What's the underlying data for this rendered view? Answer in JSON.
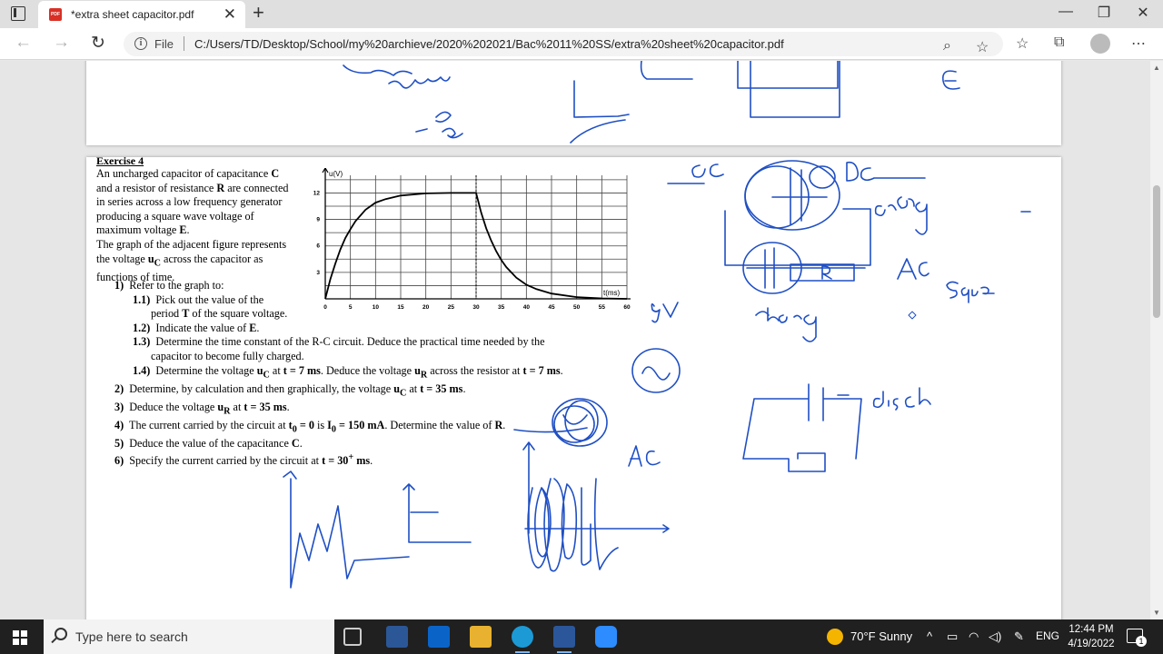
{
  "tab": {
    "title": "*extra sheet capacitor.pdf",
    "icon": "pdf-icon",
    "badge": "PDF"
  },
  "address": {
    "security_label": "File",
    "url": "C:/Users/TD/Desktop/School/my%20archieve/2020%202021/Bac%2011%20SS/extra%20sheet%20capacitor.pdf"
  },
  "document": {
    "exercise_title": "Exercise 4",
    "intro": [
      "An uncharged capacitor of capacitance <b>C</b>",
      "and a resistor of resistance <b>R</b> are connected",
      "in series across a low frequency generator",
      "producing a square wave voltage of",
      "maximum voltage <b>E</b>.",
      "The graph of the adjacent figure represents",
      "the voltage <b>u<sub>C</sub></b> across the capacitor as",
      "functions of time."
    ],
    "questions": [
      {
        "num": "1)",
        "text": "Refer to the graph to:",
        "indent": 0
      },
      {
        "num": "1.1)",
        "text": "Pick out the value of the",
        "indent": 1
      },
      {
        "num": "",
        "text": "period <b>T</b> of the square voltage.",
        "indent": 2
      },
      {
        "num": "1.2)",
        "text": "Indicate the value of <b>E</b>.",
        "indent": 1
      },
      {
        "num": "1.3)",
        "text": "Determine the time constant of the R-C circuit. Deduce the practical time needed by the",
        "indent": 1
      },
      {
        "num": "",
        "text": "capacitor to become fully charged.",
        "indent": 2
      },
      {
        "num": "1.4)",
        "text": "Determine the voltage <b>u<sub>C</sub></b> at <b>t = 7 ms</b>. Deduce the voltage <b>u<sub>R</sub></b> across the resistor at <b>t = 7 ms</b>.",
        "indent": 1
      },
      {
        "num": "2)",
        "text": "Determine, by calculation and then graphically, the voltage <b>u<sub>C</sub></b> at <b>t = 35 ms</b>.",
        "indent": 0
      },
      {
        "num": "3)",
        "text": "Deduce the voltage <b>u<sub>R</sub></b> at <b>t = 35 ms</b>.",
        "indent": 0
      },
      {
        "num": "4)",
        "text": "The current carried by the circuit at <b>t<sub>0</sub> = 0</b> is <b>I<sub>0</sub> = 150 mA</b>. Determine the value of <b>R</b>.",
        "indent": 0
      },
      {
        "num": "5)",
        "text": "Deduce the value of the capacitance <b>C</b>.",
        "indent": 0
      },
      {
        "num": "6)",
        "text": "Specify the current carried by the circuit at <b>t = 30<sup>+</sup> ms</b>.",
        "indent": 0
      }
    ]
  },
  "chart_data": {
    "type": "line",
    "ylabel": "u(V)",
    "xlabel": "t(ms)",
    "x_ticks": [
      "0",
      "5",
      "10",
      "15",
      "20",
      "25",
      "30",
      "35",
      "40",
      "45",
      "50",
      "55",
      "60"
    ],
    "y_ticks": [
      "3",
      "6",
      "9",
      "12"
    ],
    "xlim": [
      0,
      60
    ],
    "ylim": [
      0,
      14
    ],
    "grid": true,
    "series": [
      {
        "x": [
          0,
          1,
          2,
          3,
          4,
          5,
          6,
          8,
          10,
          12,
          15,
          20,
          25,
          30,
          31,
          32,
          33,
          34,
          35,
          36,
          38,
          40,
          42,
          45,
          50,
          55,
          60
        ],
        "y": [
          0,
          2.2,
          4.0,
          5.6,
          6.9,
          7.9,
          8.8,
          10.1,
          10.9,
          11.3,
          11.7,
          11.95,
          12,
          12,
          9.8,
          8.0,
          6.6,
          5.4,
          4.4,
          3.6,
          2.4,
          1.6,
          1.1,
          0.6,
          0.2,
          0.05,
          0
        ]
      }
    ],
    "annotation": "dashed vertical line at t = 30 ms"
  },
  "annotations": {
    "color": "#1f4fc4",
    "words": [
      "DC",
      "DC",
      "charg",
      "AC",
      "Squ",
      "9V",
      "charg",
      "disch",
      "AC",
      "R",
      "E"
    ]
  },
  "taskbar": {
    "search_placeholder": "Type here to search",
    "weather": "70°F  Sunny",
    "language": "ENG",
    "time": "12:44 PM",
    "date": "4/19/2022",
    "notification_count": "1",
    "apps": [
      "task-view-icon",
      "microsoft-store-icon",
      "mail-icon",
      "file-explorer-icon",
      "edge-icon",
      "word-icon",
      "zoom-icon"
    ]
  }
}
